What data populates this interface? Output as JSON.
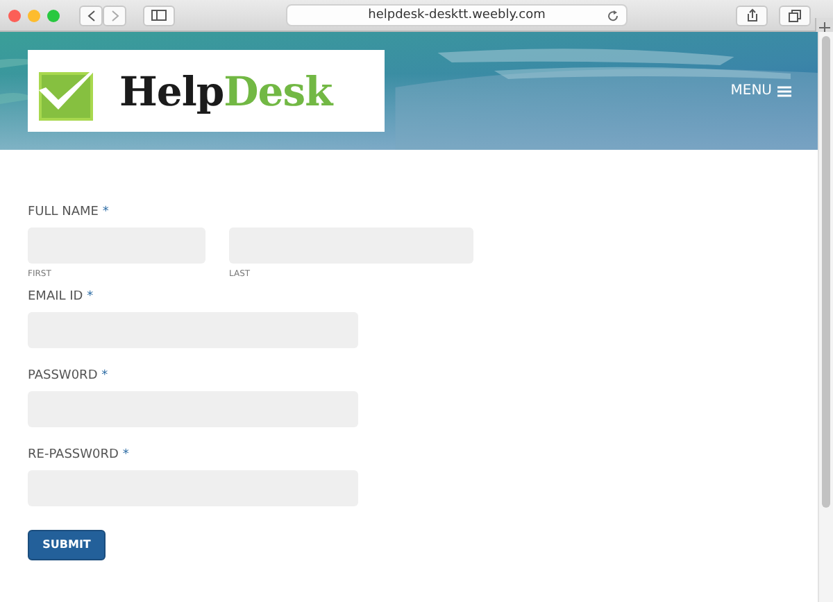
{
  "browser": {
    "url": "helpdesk-desktt.weebly.com"
  },
  "header": {
    "logo": {
      "dark_part": "Help",
      "green_part": "Desk"
    },
    "menu_label": "MENU"
  },
  "form": {
    "fields": [
      {
        "kind": "name",
        "label": "FULL NAME",
        "required_mark": "*",
        "sublabels": [
          "FIRST",
          "LAST"
        ]
      },
      {
        "kind": "text",
        "label": "EMAIL ID",
        "required_mark": "*"
      },
      {
        "kind": "text",
        "label": "PASSW0RD",
        "required_mark": "*"
      },
      {
        "kind": "text",
        "label": "RE-PASSW0RD",
        "required_mark": "*"
      }
    ],
    "submit": "SUBMIT"
  }
}
